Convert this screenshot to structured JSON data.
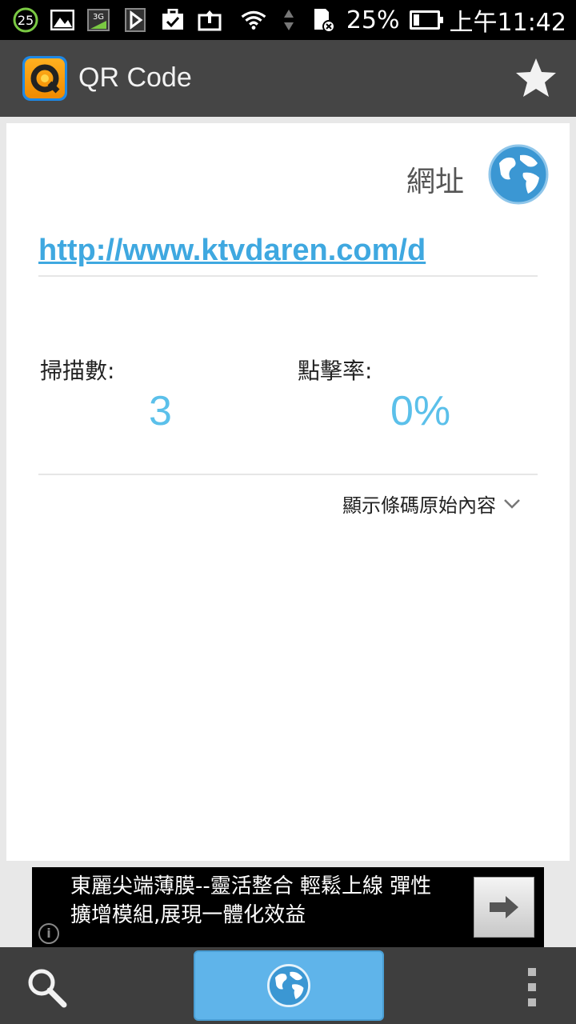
{
  "status_bar": {
    "notification_count": "25",
    "network_badge": "3G",
    "battery_percent": "25%",
    "time": "上午11:42"
  },
  "action_bar": {
    "title": "QR Code"
  },
  "result": {
    "type_label": "網址",
    "url": "http://www.ktvdaren.com/d",
    "scans_label": "掃描數:",
    "scans_value": "3",
    "ctr_label": "點擊率:",
    "ctr_value": "0%",
    "raw_toggle_label": "顯示條碼原始內容"
  },
  "ad": {
    "line1": "東麗尖端薄膜--靈活整合 輕鬆上線 彈性",
    "line2": "擴增模組,展現一體化效益",
    "info_glyph": "i"
  },
  "colors": {
    "accent_blue": "#5bc0ea",
    "link_blue": "#3fa8e0",
    "action_bar": "#454545",
    "bottom_bar": "#3e3e3e"
  }
}
